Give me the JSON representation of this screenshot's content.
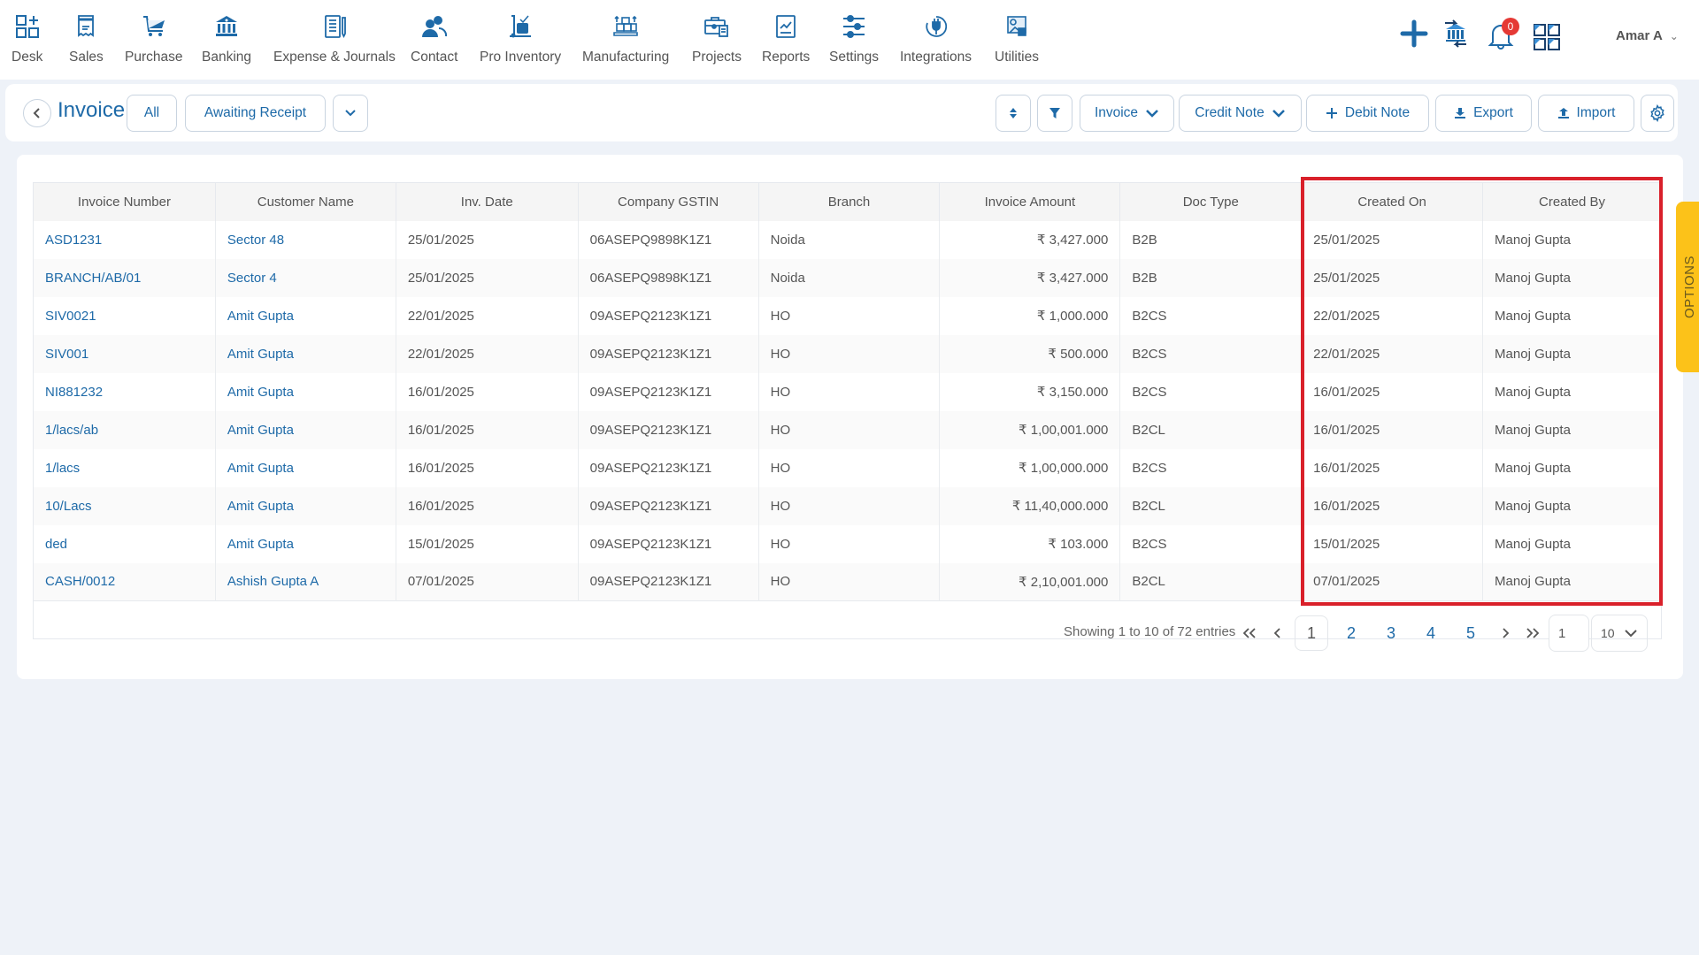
{
  "nav": {
    "items": [
      {
        "label": "Desk",
        "icon": "desk-grid-plus-icon"
      },
      {
        "label": "Sales",
        "icon": "receipt-icon"
      },
      {
        "label": "Purchase",
        "icon": "cart-icon"
      },
      {
        "label": "Banking",
        "icon": "bank-icon"
      },
      {
        "label": "Expense & Journals",
        "icon": "notebook-icon"
      },
      {
        "label": "Contact",
        "icon": "contacts-icon"
      },
      {
        "label": "Pro Inventory",
        "icon": "trolley-icon"
      },
      {
        "label": "Manufacturing",
        "icon": "boxes-icon"
      },
      {
        "label": "Projects",
        "icon": "briefcase-icon"
      },
      {
        "label": "Reports",
        "icon": "report-chart-icon"
      },
      {
        "label": "Settings",
        "icon": "sliders-icon"
      },
      {
        "label": "Integrations",
        "icon": "plug-icon"
      },
      {
        "label": "Utilities",
        "icon": "utilities-icon"
      }
    ],
    "notification_count": "0",
    "user_name": "Amar A",
    "user_chevron": "⌄"
  },
  "toolbar": {
    "back_icon": "‹",
    "title": "Invoice",
    "filter_all": "All",
    "filter_awaiting": "Awaiting Receipt",
    "invoice_dropdown": "Invoice",
    "credit_note_dropdown": "Credit Note",
    "debit_note": "Debit Note",
    "export": "Export",
    "import": "Import"
  },
  "table": {
    "columns": [
      "Invoice Number",
      "Customer Name",
      "Inv. Date",
      "Company GSTIN",
      "Branch",
      "Invoice Amount",
      "Doc Type",
      "Created On",
      "Created By"
    ],
    "rows": [
      [
        "ASD1231",
        "Sector 48",
        "25/01/2025",
        "06ASEPQ9898K1Z1",
        "Noida",
        "₹ 3,427.000",
        "B2B",
        "25/01/2025",
        "Manoj Gupta"
      ],
      [
        "BRANCH/AB/01",
        "Sector 4",
        "25/01/2025",
        "06ASEPQ9898K1Z1",
        "Noida",
        "₹ 3,427.000",
        "B2B",
        "25/01/2025",
        "Manoj Gupta"
      ],
      [
        "SIV0021",
        "Amit Gupta",
        "22/01/2025",
        "09ASEPQ2123K1Z1",
        "HO",
        "₹ 1,000.000",
        "B2CS",
        "22/01/2025",
        "Manoj Gupta"
      ],
      [
        "SIV001",
        "Amit Gupta",
        "22/01/2025",
        "09ASEPQ2123K1Z1",
        "HO",
        "₹ 500.000",
        "B2CS",
        "22/01/2025",
        "Manoj Gupta"
      ],
      [
        "NI881232",
        "Amit Gupta",
        "16/01/2025",
        "09ASEPQ2123K1Z1",
        "HO",
        "₹ 3,150.000",
        "B2CS",
        "16/01/2025",
        "Manoj Gupta"
      ],
      [
        "1/lacs/ab",
        "Amit Gupta",
        "16/01/2025",
        "09ASEPQ2123K1Z1",
        "HO",
        "₹ 1,00,001.000",
        "B2CL",
        "16/01/2025",
        "Manoj Gupta"
      ],
      [
        "1/lacs",
        "Amit Gupta",
        "16/01/2025",
        "09ASEPQ2123K1Z1",
        "HO",
        "₹ 1,00,000.000",
        "B2CS",
        "16/01/2025",
        "Manoj Gupta"
      ],
      [
        "10/Lacs",
        "Amit Gupta",
        "16/01/2025",
        "09ASEPQ2123K1Z1",
        "HO",
        "₹ 11,40,000.000",
        "B2CL",
        "16/01/2025",
        "Manoj Gupta"
      ],
      [
        "ded",
        "Amit Gupta",
        "15/01/2025",
        "09ASEPQ2123K1Z1",
        "HO",
        "₹ 103.000",
        "B2CS",
        "15/01/2025",
        "Manoj Gupta"
      ],
      [
        "CASH/0012",
        "Ashish Gupta A",
        "07/01/2025",
        "09ASEPQ2123K1Z1",
        "HO",
        "₹ 2,10,001.000",
        "B2CL",
        "07/01/2025",
        "Manoj Gupta"
      ]
    ]
  },
  "pagination": {
    "summary": "Showing 1 to 10 of 72 entries",
    "first": "«",
    "prev": "‹",
    "pages": [
      "1",
      "2",
      "3",
      "4",
      "5"
    ],
    "current_page": "1",
    "next": "›",
    "last": "»",
    "goto_value": "1",
    "page_size": "10"
  },
  "options_tab": "OPTIONS",
  "colors": {
    "accent": "#1e6aa8",
    "highlight": "#d9202a",
    "options": "#fcc219",
    "badge": "#e53935"
  }
}
